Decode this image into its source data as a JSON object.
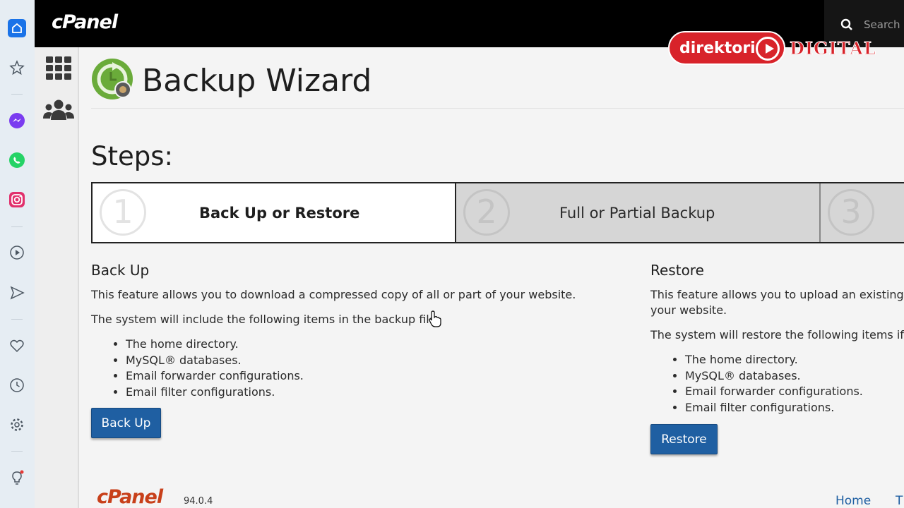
{
  "browser_rail": {
    "icons": [
      "home-icon",
      "star-icon",
      "messenger-icon",
      "whatsapp-icon",
      "instagram-icon",
      "play-icon",
      "send-icon",
      "heart-icon",
      "history-icon",
      "settings-icon",
      "lightbulb-icon"
    ]
  },
  "topbar": {
    "logo": "cPanel",
    "search_placeholder": "Search ("
  },
  "watermark": {
    "brand_left": "direktori",
    "brand_right": "DIGITAL"
  },
  "page": {
    "title": "Backup Wizard",
    "steps_heading": "Steps:"
  },
  "steps": [
    {
      "number": "1",
      "label": "Back Up or Restore",
      "active": true
    },
    {
      "number": "2",
      "label": "Full or Partial Backup",
      "active": false
    },
    {
      "number": "3",
      "label": "",
      "active": false
    }
  ],
  "backup": {
    "heading": "Back Up",
    "desc1": "This feature allows you to download a compressed copy of all or part of your website.",
    "desc2": "The system will include the following items in the backup file",
    "items": [
      "The home directory.",
      "MySQL® databases.",
      "Email forwarder configurations.",
      "Email filter configurations."
    ],
    "button": "Back Up"
  },
  "restore": {
    "heading": "Restore",
    "desc1": "This feature allows you to upload an existing",
    "desc1b": "your website.",
    "desc2": "The system will restore the following items if",
    "items": [
      "The home directory.",
      "MySQL® databases.",
      "Email forwarder configurations.",
      "Email filter configurations."
    ],
    "button": "Restore"
  },
  "footer": {
    "logo": "cPanel",
    "version": "94.0.4",
    "links": [
      "Home",
      "T"
    ]
  },
  "colors": {
    "accent": "#1f5fa2",
    "brand_orange": "#c8401a",
    "watermark_red": "#d8232a"
  }
}
